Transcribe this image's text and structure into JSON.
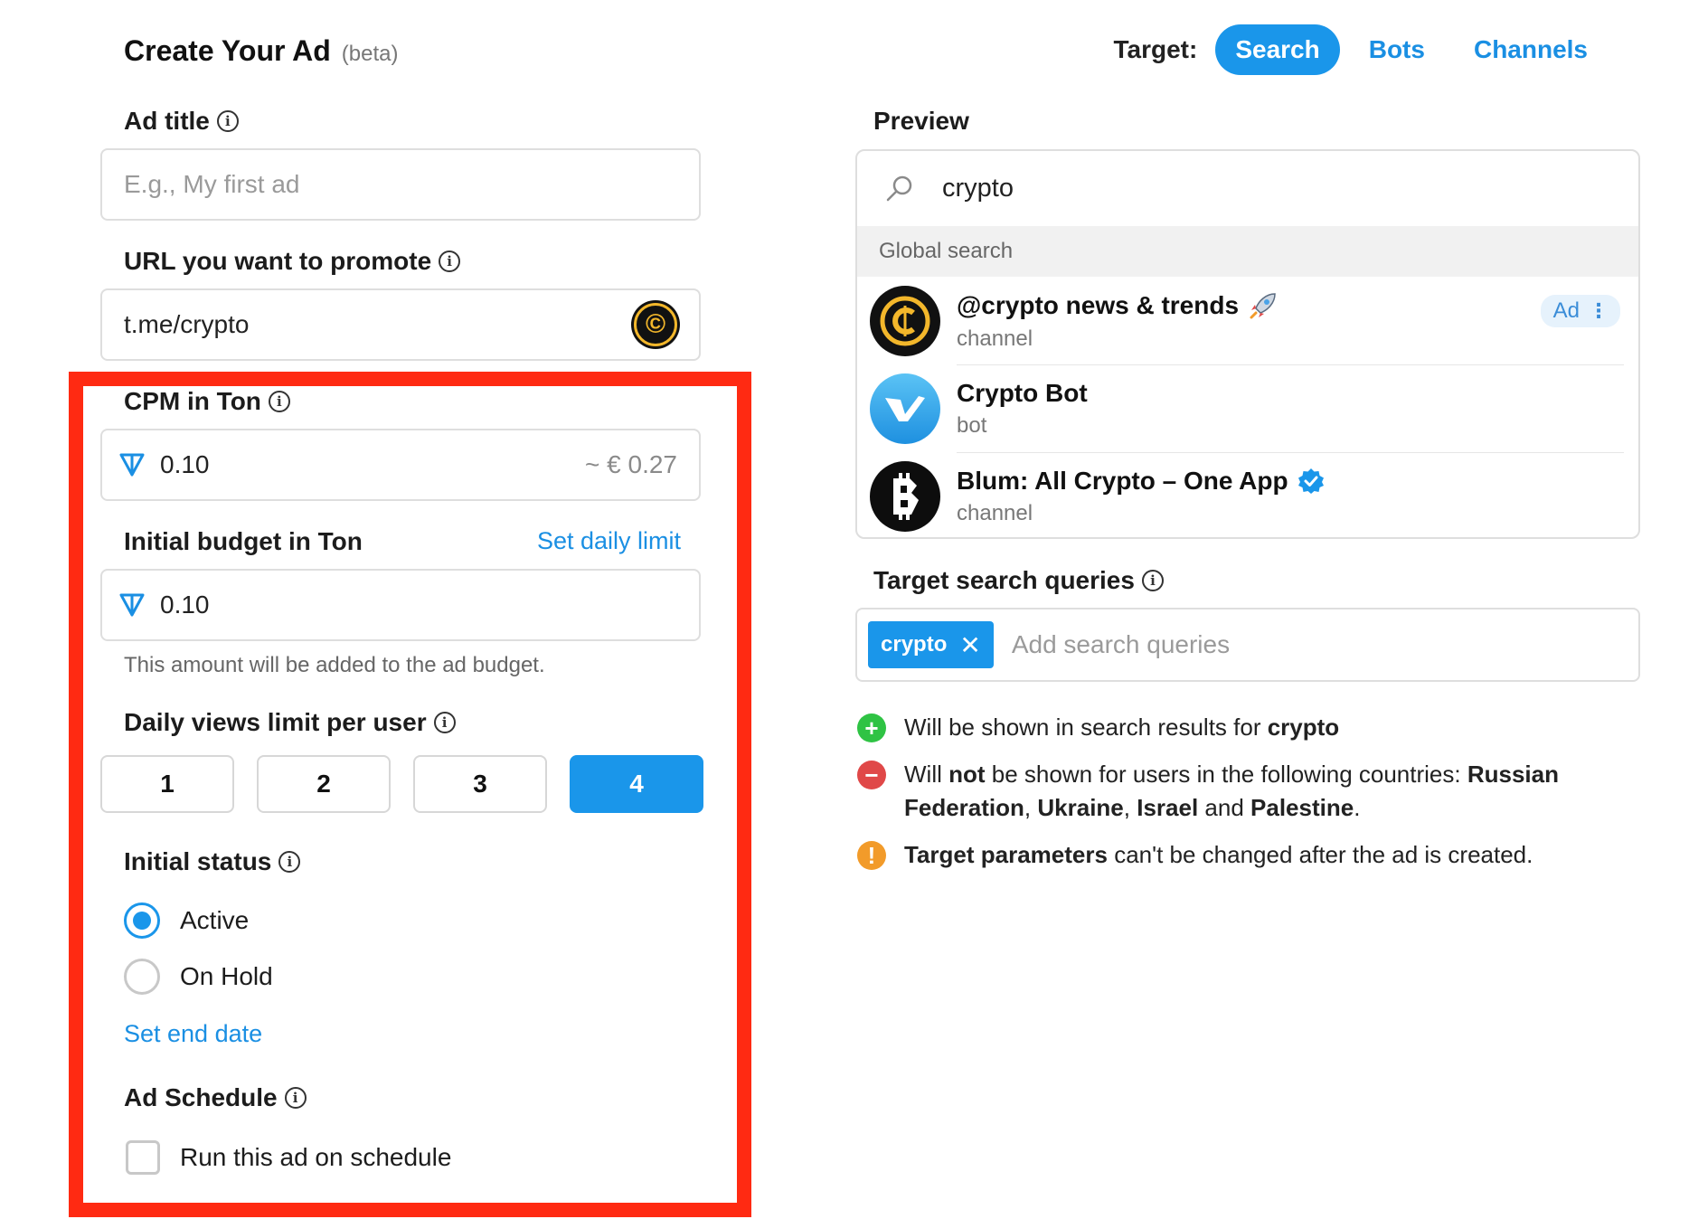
{
  "header": {
    "title": "Create Your Ad",
    "beta": "(beta)",
    "target_label": "Target:",
    "tabs": [
      {
        "label": "Search",
        "active": true
      },
      {
        "label": "Bots",
        "active": false
      },
      {
        "label": "Channels",
        "active": false
      }
    ]
  },
  "form": {
    "ad_title": {
      "label": "Ad title",
      "placeholder": "E.g., My first ad",
      "value": ""
    },
    "url": {
      "label": "URL you want to promote",
      "value": "t.me/crypto"
    },
    "cpm": {
      "label": "CPM in Ton",
      "value": "0.10",
      "converted": "~ € 0.27"
    },
    "budget": {
      "label": "Initial budget in Ton",
      "link": "Set daily limit",
      "value": "0.10",
      "hint": "This amount will be added to the ad budget."
    },
    "daily_views": {
      "label": "Daily views limit per user",
      "options": [
        "1",
        "2",
        "3",
        "4"
      ],
      "selected": "4"
    },
    "status": {
      "label": "Initial status",
      "options": [
        "Active",
        "On Hold"
      ],
      "selected": "Active",
      "link": "Set end date"
    },
    "schedule": {
      "label": "Ad Schedule",
      "checkbox_label": "Run this ad on schedule",
      "checked": false
    }
  },
  "preview": {
    "label": "Preview",
    "query": "crypto",
    "section": "Global search",
    "results": [
      {
        "name": "@crypto news & trends",
        "type": "channel",
        "badge": "Ad"
      },
      {
        "name": "Crypto Bot",
        "type": "bot"
      },
      {
        "name": "Blum: All Crypto – One App",
        "type": "channel"
      }
    ]
  },
  "target_queries": {
    "label": "Target search queries",
    "chips": [
      "crypto"
    ],
    "placeholder": "Add search queries"
  },
  "notes": {
    "shown_prefix": "Will be shown in search results for",
    "shown_query": "crypto",
    "not_1": "Will",
    "not_2": "not",
    "not_3": "be shown for users in the following countries:",
    "country_1": "Russian Federation",
    "country_2": "Ukraine",
    "country_3": "Israel",
    "and": "and",
    "country_4": "Palestine",
    "warn_bold": "Target parameters",
    "warn_rest": "can't be changed after the ad is created."
  },
  "colors": {
    "accent": "#1a96ea",
    "highlight": "#ff2a12"
  }
}
